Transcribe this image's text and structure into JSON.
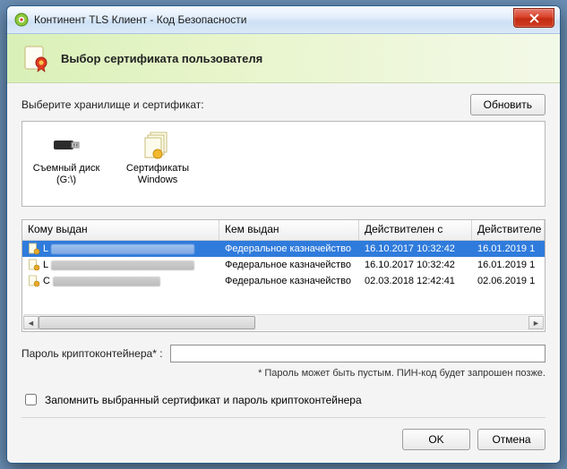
{
  "window": {
    "title": "Континент TLS Клиент - Код Безопасности"
  },
  "banner": {
    "title": "Выбор сертификата пользователя"
  },
  "instruction": "Выберите хранилище и сертификат:",
  "refresh_label": "Обновить",
  "storages": [
    {
      "label": "Съемный диск (G:\\)"
    },
    {
      "label": "Сертификаты Windows"
    }
  ],
  "columns": {
    "issued_to": "Кому выдан",
    "issued_by": "Кем выдан",
    "valid_from": "Действителен с",
    "valid_to": "Действителе"
  },
  "rows": [
    {
      "name_initial": "L",
      "issuer": "Федеральное казначейство",
      "from": "16.10.2017 10:32:42",
      "to": "16.01.2019 1",
      "selected": true
    },
    {
      "name_initial": "L",
      "issuer": "Федеральное казначейство",
      "from": "16.10.2017 10:32:42",
      "to": "16.01.2019 1",
      "selected": false
    },
    {
      "name_initial": "C",
      "issuer": "Федеральное казначейство",
      "from": "02.03.2018 12:42:41",
      "to": "02.06.2019 1",
      "selected": false
    }
  ],
  "password": {
    "label": "Пароль криптоконтейнера* :",
    "value": "",
    "hint": "* Пароль может быть пустым. ПИН-код будет запрошен позже."
  },
  "remember": {
    "label": "Запомнить выбранный сертификат и пароль криптоконтейнера",
    "checked": false
  },
  "buttons": {
    "ok": "OK",
    "cancel": "Отмена"
  }
}
